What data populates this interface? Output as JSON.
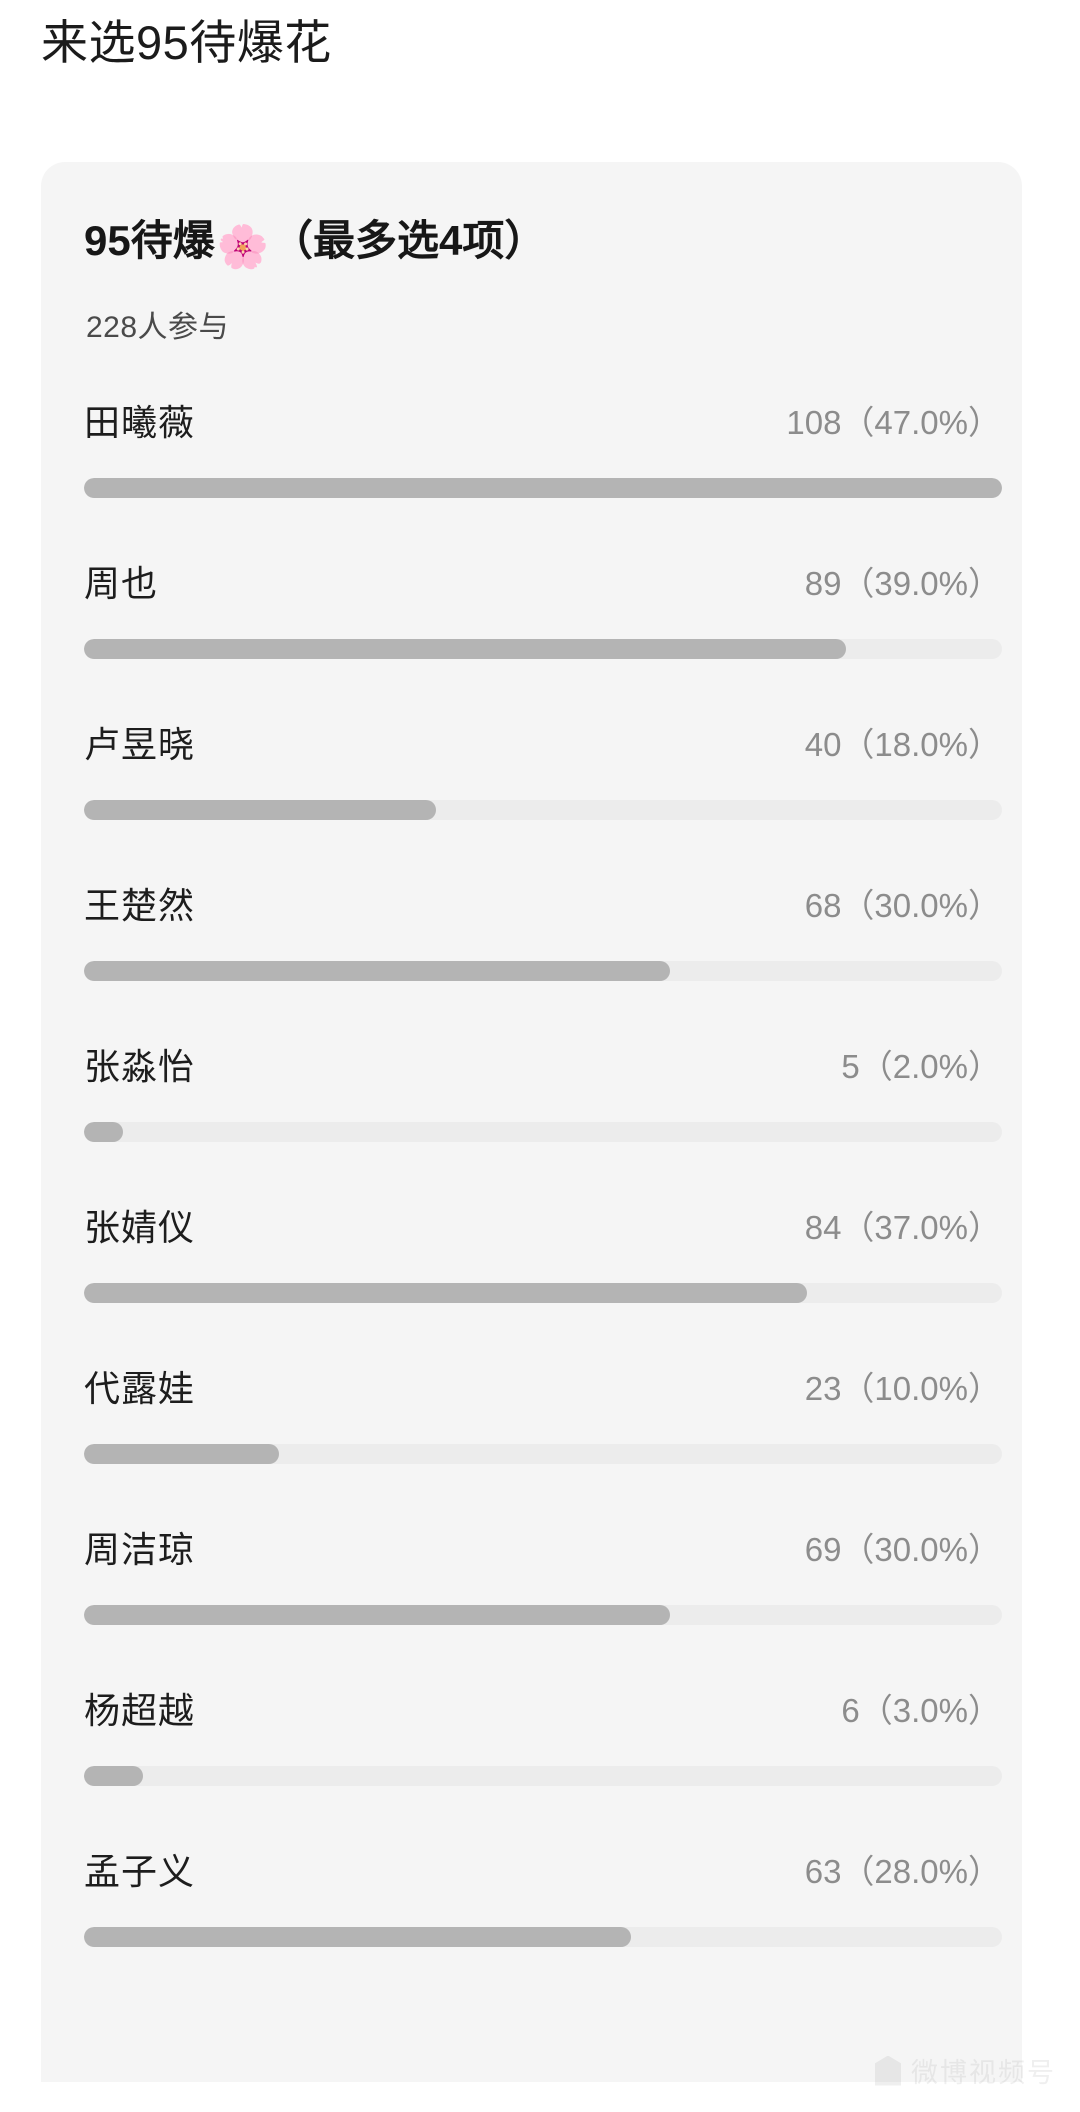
{
  "page": {
    "headline": "来选95待爆花",
    "background_color": "#ffffff"
  },
  "poll": {
    "title_prefix": "95待爆",
    "title_emoji": "🌸",
    "title_suffix": "（最多选4项）",
    "title_full": "95待爆🌸（最多选4项）",
    "participants": "228人参与",
    "participant_count": 228,
    "max_choices": 4,
    "card_color": "#f5f5f5",
    "bar_fill_color": "#b4b4b4",
    "bar_track_color": "#ececec",
    "options": [
      {
        "label": "田曦薇",
        "votes": 108,
        "percent": "47.0",
        "value_text": "108（47.0%）"
      },
      {
        "label": "周也",
        "votes": 89,
        "percent": "39.0",
        "value_text": "89（39.0%）"
      },
      {
        "label": "卢昱晓",
        "votes": 40,
        "percent": "18.0",
        "value_text": "40（18.0%）"
      },
      {
        "label": "王楚然",
        "votes": 68,
        "percent": "30.0",
        "value_text": "68（30.0%）"
      },
      {
        "label": "张淼怡",
        "votes": 5,
        "percent": "2.0",
        "value_text": "5（2.0%）"
      },
      {
        "label": "张婧仪",
        "votes": 84,
        "percent": "37.0",
        "value_text": "84（37.0%）"
      },
      {
        "label": "代露娃",
        "votes": 23,
        "percent": "10.0",
        "value_text": "23（10.0%）"
      },
      {
        "label": "周洁琼",
        "votes": 69,
        "percent": "30.0",
        "value_text": "69（30.0%）"
      },
      {
        "label": "杨超越",
        "votes": 6,
        "percent": "3.0",
        "value_text": "6（3.0%）"
      },
      {
        "label": "孟子义",
        "votes": 63,
        "percent": "28.0",
        "value_text": "63（28.0%）"
      }
    ]
  },
  "watermark": {
    "text": "微博视频号"
  },
  "chart_data": {
    "type": "bar",
    "title": "95待爆🌸（最多选4项）",
    "subtitle": "228人参与",
    "orientation": "horizontal",
    "categories": [
      "田曦薇",
      "周也",
      "卢昱晓",
      "王楚然",
      "张淼怡",
      "张婧仪",
      "代露娃",
      "周洁琼",
      "杨超越",
      "孟子义"
    ],
    "values": [
      108,
      89,
      40,
      68,
      5,
      84,
      23,
      69,
      6,
      63
    ],
    "percentages": [
      47.0,
      39.0,
      18.0,
      30.0,
      2.0,
      37.0,
      10.0,
      30.0,
      3.0,
      28.0
    ],
    "xlabel": "",
    "ylabel": "",
    "xlim": [
      0,
      100
    ],
    "grid": false,
    "legend": "none",
    "bar_scale_basis": "percent_of_participants",
    "max_bar_percent": 47.0
  }
}
